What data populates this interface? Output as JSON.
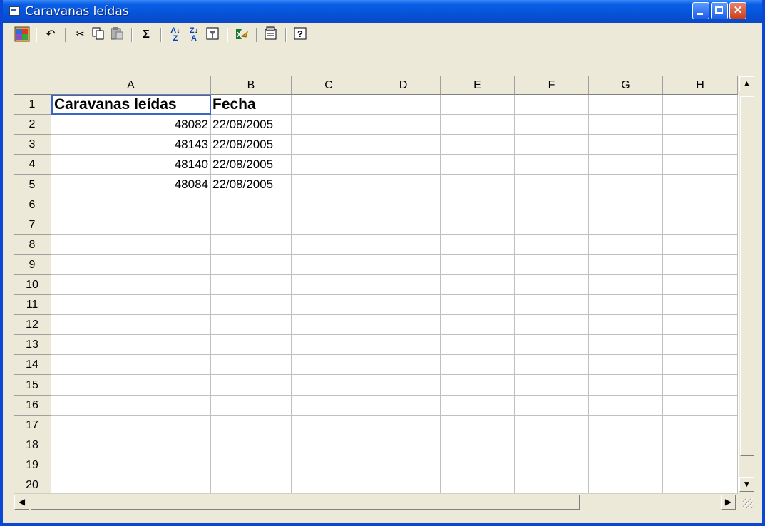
{
  "window": {
    "title": "Caravanas leídas"
  },
  "titlebar_buttons": [
    "minimize",
    "maximize",
    "close"
  ],
  "toolbar": {
    "tools": [
      {
        "name": "office-logo-icon",
        "glyph": ""
      },
      {
        "name": "undo-icon",
        "glyph": "↶"
      },
      {
        "name": "cut-icon",
        "glyph": "✂"
      },
      {
        "name": "copy-icon",
        "glyph": "⎘"
      },
      {
        "name": "paste-icon",
        "glyph": "📋"
      },
      {
        "name": "autosum-icon",
        "glyph": "Σ"
      },
      {
        "name": "sort-ascending-icon",
        "glyph": "A↓"
      },
      {
        "name": "sort-descending-icon",
        "glyph": "Z↓"
      },
      {
        "name": "autofilter-icon",
        "glyph": "▽"
      },
      {
        "name": "export-to-excel-icon",
        "glyph": ""
      },
      {
        "name": "property-toolbox-icon",
        "glyph": ""
      },
      {
        "name": "help-icon",
        "glyph": "?"
      }
    ]
  },
  "sheet": {
    "columns": [
      "A",
      "B",
      "C",
      "D",
      "E",
      "F",
      "G",
      "H"
    ],
    "rows": [
      "1",
      "2",
      "3",
      "4",
      "5",
      "6",
      "7",
      "8",
      "9",
      "10",
      "11",
      "12",
      "13",
      "14",
      "15",
      "16",
      "17",
      "18",
      "19",
      "20"
    ],
    "cells": {
      "A1": "Caravanas leídas",
      "B1": "Fecha",
      "A2": "48082",
      "B2": "22/08/2005",
      "A3": "48143",
      "B3": "22/08/2005",
      "A4": "48140",
      "B4": "22/08/2005",
      "A5": "48084",
      "B5": "22/08/2005"
    },
    "selected_cell": "A1"
  },
  "colors": {
    "titlebar": "#0553d8",
    "selection_border": "#3a64c8",
    "chrome": "#ece9d8"
  }
}
